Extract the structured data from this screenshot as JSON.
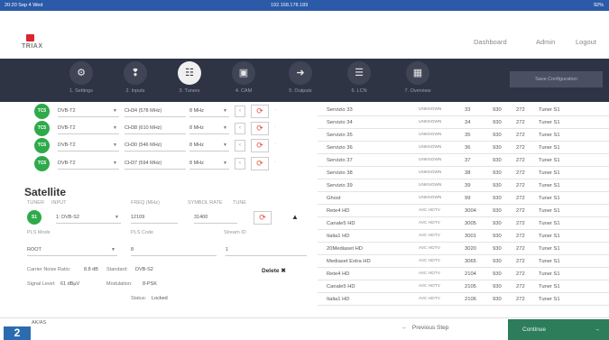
{
  "status": {
    "time": "20:20",
    "date": "Sep 4 Wed",
    "url": "192.168.178.189",
    "battery": "92%"
  },
  "brand": {
    "name": "TRIAX",
    "color": "#d8262b"
  },
  "topnav": {
    "dashboard": "Dashboard",
    "admin": "Admin",
    "logout": "Logout"
  },
  "steps": [
    {
      "label": "1. Settings",
      "icon": "gear-icon"
    },
    {
      "label": "2. Inputs",
      "icon": "plug-icon"
    },
    {
      "label": "3. Tuners",
      "icon": "tuner-icon"
    },
    {
      "label": "4. CAM",
      "icon": "card-icon"
    },
    {
      "label": "5. Outputs",
      "icon": "output-icon"
    },
    {
      "label": "6. LCN",
      "icon": "list-icon"
    },
    {
      "label": "7. Overview",
      "icon": "grid-icon"
    }
  ],
  "save_label": "Save Configuration",
  "tuners": [
    {
      "badge": "TC5",
      "standard": "DVB-T2",
      "channel": "CH34 (578 MHz)",
      "bw": "8 MHz"
    },
    {
      "badge": "TC5",
      "standard": "DVB-T2",
      "channel": "CH38 (610 MHz)",
      "bw": "8 MHz"
    },
    {
      "badge": "TC6",
      "standard": "DVB-T2",
      "channel": "CH30 (546 MHz)",
      "bw": "8 MHz"
    },
    {
      "badge": "TC6",
      "standard": "DVB-T2",
      "channel": "CH37 (594 MHz)",
      "bw": "8 MHz"
    }
  ],
  "satellite": {
    "title": "Satellite",
    "headers": {
      "tuner": "TUNER",
      "input": "INPUT",
      "freq": "FREQ (MHz)",
      "sr": "SYMBOL RATE",
      "tune": "TUNE"
    },
    "badge": "S1",
    "input": "1: DVB-S2",
    "freq": "12109",
    "sr": "31400",
    "pls_mode_label": "PLS Mode",
    "pls_mode": "ROOT",
    "pls_code_label": "PLS Code",
    "pls_code": "8",
    "stream_label": "Stream ID",
    "stream": "1",
    "cnr_label": "Carrier Noise Ratio:",
    "cnr": "8.8 dB",
    "std_label": "Standard:",
    "std": "DVB-S2",
    "lvl_label": "Signal Level:",
    "lvl": "61 dBµV",
    "mod_label": "Modulation:",
    "mod": "8-PSK",
    "status_label": "Status:",
    "status": "Locked",
    "delete_label": "Delete"
  },
  "services": [
    {
      "name": "Servizio 33",
      "type": "UNKNOWN",
      "num": "33",
      "sid": "930",
      "pid": "272",
      "tuner": "Tuner S1"
    },
    {
      "name": "Servizio 34",
      "type": "UNKNOWN",
      "num": "34",
      "sid": "930",
      "pid": "272",
      "tuner": "Tuner S1"
    },
    {
      "name": "Servizio 35",
      "type": "UNKNOWN",
      "num": "35",
      "sid": "930",
      "pid": "272",
      "tuner": "Tuner S1"
    },
    {
      "name": "Servizio 36",
      "type": "UNKNOWN",
      "num": "36",
      "sid": "930",
      "pid": "272",
      "tuner": "Tuner S1"
    },
    {
      "name": "Servizio 37",
      "type": "UNKNOWN",
      "num": "37",
      "sid": "930",
      "pid": "272",
      "tuner": "Tuner S1"
    },
    {
      "name": "Servizio 38",
      "type": "UNKNOWN",
      "num": "38",
      "sid": "930",
      "pid": "272",
      "tuner": "Tuner S1"
    },
    {
      "name": "Servizio 39",
      "type": "UNKNOWN",
      "num": "39",
      "sid": "930",
      "pid": "272",
      "tuner": "Tuner S1"
    },
    {
      "name": "Ghost",
      "type": "UNKNOWN",
      "num": "99",
      "sid": "930",
      "pid": "272",
      "tuner": "Tuner S1"
    },
    {
      "name": "Rete4 HD",
      "type": "AVC HDTV",
      "num": "3004",
      "sid": "930",
      "pid": "272",
      "tuner": "Tuner S1"
    },
    {
      "name": "Canale5 HD",
      "type": "AVC HDTV",
      "num": "3005",
      "sid": "930",
      "pid": "272",
      "tuner": "Tuner S1"
    },
    {
      "name": "Italia1 HD",
      "type": "AVC HDTV",
      "num": "3001",
      "sid": "930",
      "pid": "272",
      "tuner": "Tuner S1"
    },
    {
      "name": "20Mediaset HD",
      "type": "AVC HDTV",
      "num": "3020",
      "sid": "930",
      "pid": "272",
      "tuner": "Tuner S1"
    },
    {
      "name": "Mediaset Extra HD",
      "type": "AVC HDTV",
      "num": "3065",
      "sid": "930",
      "pid": "272",
      "tuner": "Tuner S1"
    },
    {
      "name": "Rete4 HD",
      "type": "AVC HDTV",
      "num": "2104",
      "sid": "930",
      "pid": "272",
      "tuner": "Tuner S1"
    },
    {
      "name": "Canale5 HD",
      "type": "AVC HDTV",
      "num": "2105",
      "sid": "930",
      "pid": "272",
      "tuner": "Tuner S1"
    },
    {
      "name": "Italia1 HD",
      "type": "AVC HDTV",
      "num": "2106",
      "sid": "930",
      "pid": "272",
      "tuner": "Tuner S1"
    }
  ],
  "footer": {
    "step_badge": "2",
    "section_label": "AK/AS",
    "prev_label": "Previous Step",
    "next_label": "Continue"
  }
}
